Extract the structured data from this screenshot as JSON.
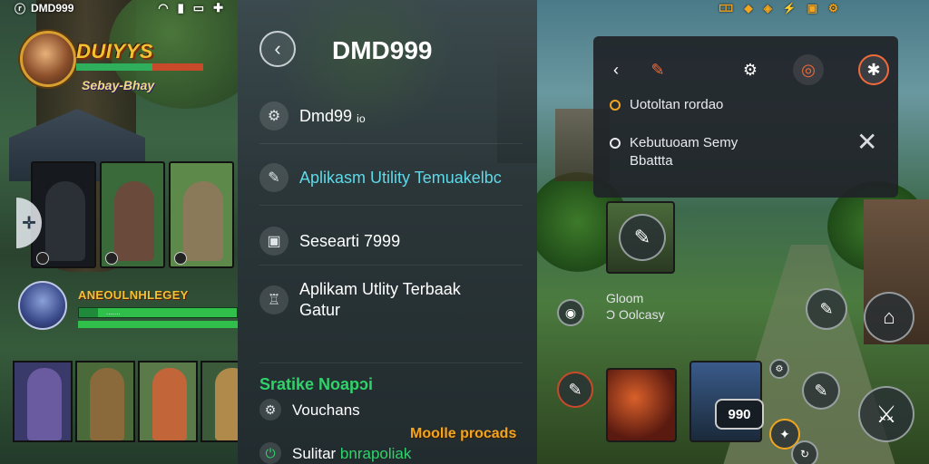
{
  "left_panel": {
    "status": {
      "app_icon": "ⓡ",
      "title": "DMD999",
      "right_icons": [
        "wifi-icon",
        "signal-icon",
        "battery-icon",
        "gift-icon"
      ]
    },
    "brand": {
      "title": "DUIYYS",
      "subtitle": "Sebay-Bhay"
    },
    "nav_arrow": "✛",
    "banner": {
      "title": "ANEOULNHLEGEY",
      "bar_text": "......."
    },
    "cards": [
      {
        "bg": "#161a1f",
        "fig": "#2b2f36"
      },
      {
        "bg": "#3a6a3a",
        "fig": "#6a4a3a"
      },
      {
        "bg": "#5d8a4a",
        "fig": "#8a7a5a"
      }
    ],
    "bottom_cards": [
      {
        "bg": "#3a3a6a",
        "fig": "#6a5aa0"
      },
      {
        "bg": "#4a6a3a",
        "fig": "#8a6a3a"
      },
      {
        "bg": "#5a7a4a",
        "fig": "#c2663a"
      },
      {
        "bg": "#3a5a3a",
        "fig": "#b08a4a"
      }
    ]
  },
  "center_panel": {
    "title": "DMD999",
    "back_label": "‹",
    "items": [
      {
        "icon": "⚙",
        "label": "Dmd99 ᵢₒ"
      },
      {
        "icon": "✎",
        "label": "Aplikasm Utility Temuakelbc"
      },
      {
        "icon": "▣",
        "label": "Sesearti 7999"
      },
      {
        "icon": "♖",
        "label": "Aplikam Utlity Terbaak",
        "label2": "Gatur"
      }
    ],
    "section_title": "Sratike Noapɔi",
    "section_items": [
      {
        "icon": "⚙",
        "label": "Vouchans"
      },
      {
        "icon": "⏻",
        "label": "Sulitar",
        "label_green": "bnrapoliak"
      }
    ],
    "badge": "Moolle procads"
  },
  "right_panel": {
    "status_icons": [
      "🀱",
      "◆",
      "◈",
      "⚡",
      "▣",
      "⚙"
    ],
    "popup": {
      "toolbar": [
        "‹",
        "✎",
        "⚙",
        "◎",
        "✱"
      ],
      "rows": [
        {
          "label": "Uotoltan rordao",
          "dot": "#f1a520"
        },
        {
          "label": "Kebutuoam Semy",
          "label2": "Bbattta",
          "dot": "#e8ecef"
        }
      ],
      "close": "✕"
    },
    "text_block": {
      "line1": "Gloom",
      "line2": "Ɔ Oolcasy"
    },
    "score": "990"
  }
}
